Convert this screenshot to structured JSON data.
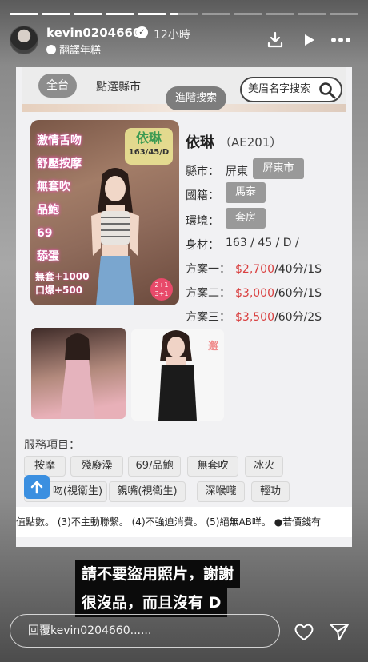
{
  "story": {
    "progress": [
      1,
      1,
      1,
      1,
      1,
      0.3,
      0,
      0,
      0,
      0,
      0
    ],
    "username": "kevin0204660",
    "time": "12小時",
    "translate_label": "翻譯年糕"
  },
  "screenshot": {
    "topbar": {
      "all_label": "全台",
      "city_label": "點選縣市",
      "advanced_search": "進階搜索",
      "name_search": "美眉名字搜索"
    },
    "photo_overlay": {
      "side_lines": [
        "激情舌吻",
        "舒壓按摩",
        "無套吹",
        "品鮑",
        "69",
        "舔蛋"
      ],
      "name_tag_line1": "依琳",
      "name_tag_line2": "163/45/D",
      "promo_line1": "無套+1000",
      "promo_line2": "口爆+500",
      "badge_line1": "2+1",
      "badge_line2": "3+1"
    },
    "profile": {
      "name": "依琳",
      "code": "（AE201）",
      "county_label": "縣市：",
      "county_value": "屏東",
      "county_tag": "屏東市",
      "nationality_label": "國籍：",
      "nationality_tag": "馬泰",
      "environment_label": "環境：",
      "environment_tag": "套房",
      "body_label": "身材：",
      "body_value": "163 / 45 / D /",
      "plans": [
        {
          "label": "方案一：",
          "price": "$2,700",
          "detail": "/40分/1S"
        },
        {
          "label": "方案二：",
          "price": "$3,000",
          "detail": "/60分/1S"
        },
        {
          "label": "方案三：",
          "price": "$3,500",
          "detail": "/60分/2S"
        }
      ]
    },
    "thumb_brand": "邂",
    "services": {
      "title": "服務項目：",
      "row1": [
        "按摩",
        "殘廢澡",
        "69/品鮑",
        "無套吹",
        "冰火"
      ],
      "row2": [
        "吻(視衛生)",
        "親嘴(視衛生)",
        "深喉嚨",
        "輕功"
      ]
    },
    "notes": "值點數。 (3)不主動聯繫。 (4)不強迫消費。 (5)絕無AB咩。 ●若價錢有"
  },
  "caption": {
    "line1": "請不要盜用照片，謝謝",
    "line2": "很沒品，而且沒有 D"
  },
  "reply": {
    "placeholder": "回覆kevin0204660......"
  }
}
